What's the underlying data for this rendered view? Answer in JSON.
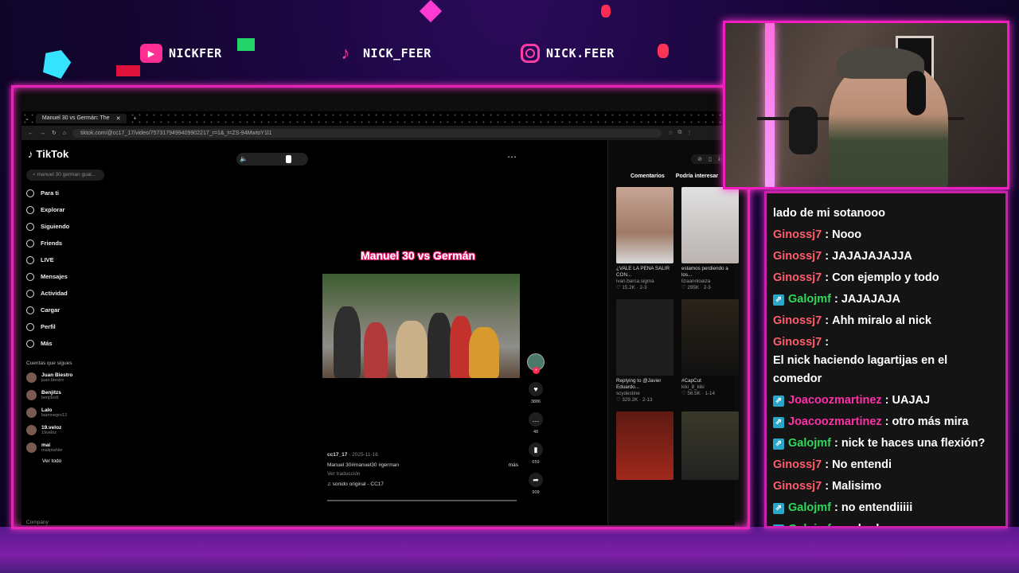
{
  "socials": [
    {
      "platform": "youtube",
      "handle": "NICKFER"
    },
    {
      "platform": "tiktok",
      "handle": "NICK_FEER"
    },
    {
      "platform": "instagram",
      "handle": "NICK.FEER"
    }
  ],
  "browser": {
    "tab_title": "Manuel 30 vs Germán: The",
    "url": "tiktok.com/@cc17_17/video/7573179499409902217_r=1&_t=ZS-94MwtoY1l1"
  },
  "tiktok": {
    "logo": "TikTok",
    "search_placeholder": "manuel 30 german gual...",
    "nav": [
      {
        "label": "Para ti",
        "icon": "home-icon"
      },
      {
        "label": "Explorar",
        "icon": "compass-icon"
      },
      {
        "label": "Siguiendo",
        "icon": "users-icon"
      },
      {
        "label": "Friends",
        "icon": "friends-icon"
      },
      {
        "label": "LIVE",
        "icon": "live-icon"
      },
      {
        "label": "Mensajes",
        "icon": "message-icon"
      },
      {
        "label": "Actividad",
        "icon": "bell-icon"
      },
      {
        "label": "Cargar",
        "icon": "upload-icon"
      },
      {
        "label": "Perfil",
        "icon": "profile-icon"
      },
      {
        "label": "Más",
        "icon": "more-icon"
      }
    ],
    "following_title": "Cuentas que sigues",
    "following": [
      {
        "name": "Juan Biestro",
        "handle": "juan.biestro"
      },
      {
        "name": "Benjitzs",
        "handle": "benjitzs6"
      },
      {
        "name": "Lalo",
        "handle": "laamnegro13"
      },
      {
        "name": "19.veloz",
        "handle": "19veloz"
      },
      {
        "name": "mai",
        "handle": "maliptahler"
      }
    ],
    "see_all": "Ver todo",
    "company": "Company",
    "video": {
      "title_overlay": "Manuel 30 vs Germán",
      "author": "cc17_17",
      "date": "· 2025-11-16",
      "description": "Manuel 30#manuel30 #german",
      "more": "más",
      "translate": "Ver traducción",
      "sound": "♫ sonido original - CC17",
      "likes": "3886",
      "comments": "48",
      "saves": "659",
      "shares": "909"
    },
    "right_tabs": [
      "Comentarios",
      "Podría interesar"
    ],
    "thumbs": [
      {
        "desc": "¿VALE LA PENA SALIR CON...",
        "user": "ivan.barca.sigma",
        "stats": "♡ 15.2K · 2-3"
      },
      {
        "desc": "estamos perdiendo a los...",
        "user": "lizaannloaiza",
        "stats": "♡ 295K · 2-3"
      },
      {
        "desc": "Replying to @Javier Eduardo...",
        "user": "scydestine",
        "stats": "♡ 329.2K · 2-13"
      },
      {
        "desc": "#CapCut",
        "user": "kiki_8_kiki",
        "stats": "♡ 56.5K · 1-14"
      }
    ]
  },
  "chat": [
    {
      "user": "",
      "message": "lado de mi sotanooo",
      "color": "#ffffff",
      "badge": false
    },
    {
      "user": "Ginossj7",
      "message": "Nooo",
      "color": "#ff5c6c",
      "badge": false
    },
    {
      "user": "Ginossj7",
      "message": "JAJAJAJAJJA",
      "color": "#ff5c6c",
      "badge": false
    },
    {
      "user": "Ginossj7",
      "message": "Con ejemplo y todo",
      "color": "#ff5c6c",
      "badge": false
    },
    {
      "user": "Galojmf",
      "message": "JAJAJAJA",
      "color": "#31d85a",
      "badge": true
    },
    {
      "user": "Ginossj7",
      "message": "Ahh miralo al nick",
      "color": "#ff5c6c",
      "badge": false
    },
    {
      "user": "Ginossj7",
      "message": "El nick haciendo lagartijas en el comedor",
      "color": "#ff5c6c",
      "badge": false
    },
    {
      "user": "Joacoozmartinez",
      "message": "UAJAJ",
      "color": "#ff2fa8",
      "badge": true
    },
    {
      "user": "Joacoozmartinez",
      "message": "otro más mira",
      "color": "#ff2fa8",
      "badge": true
    },
    {
      "user": "Galojmf",
      "message": "nick te haces una flexión?",
      "color": "#31d85a",
      "badge": true
    },
    {
      "user": "Ginossj7",
      "message": "No entendi",
      "color": "#ff5c6c",
      "badge": false
    },
    {
      "user": "Ginossj7",
      "message": "Malisimo",
      "color": "#ff5c6c",
      "badge": false
    },
    {
      "user": "Galojmf",
      "message": "no entendiiiii",
      "color": "#31d85a",
      "badge": true
    },
    {
      "user": "Galojmf",
      "message": "malardo",
      "color": "#31d85a",
      "badge": true
    }
  ]
}
